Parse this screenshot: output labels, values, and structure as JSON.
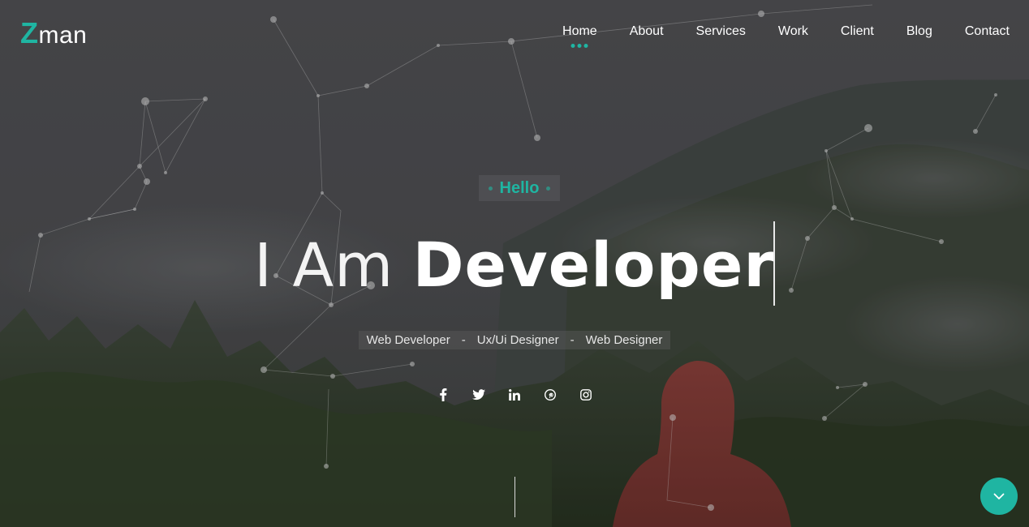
{
  "brand": {
    "logo_first": "Z",
    "logo_rest": "man",
    "accent": "#1fb5a2"
  },
  "nav": {
    "items": [
      {
        "label": "Home",
        "active": true
      },
      {
        "label": "About"
      },
      {
        "label": "Services"
      },
      {
        "label": "Work"
      },
      {
        "label": "Client"
      },
      {
        "label": "Blog"
      },
      {
        "label": "Contact"
      }
    ]
  },
  "hero": {
    "greeting": "Hello",
    "headline_light": "I Am",
    "headline_bold": "Developer",
    "roles": [
      "Web Developer",
      "Ux/Ui Designer",
      "Web Designer"
    ],
    "role_separator": "-"
  },
  "social": {
    "icons": [
      "facebook-icon",
      "twitter-icon",
      "linkedin-icon",
      "pinterest-icon",
      "instagram-icon"
    ]
  },
  "scroll_button": {
    "icon": "chevron-down-icon"
  }
}
